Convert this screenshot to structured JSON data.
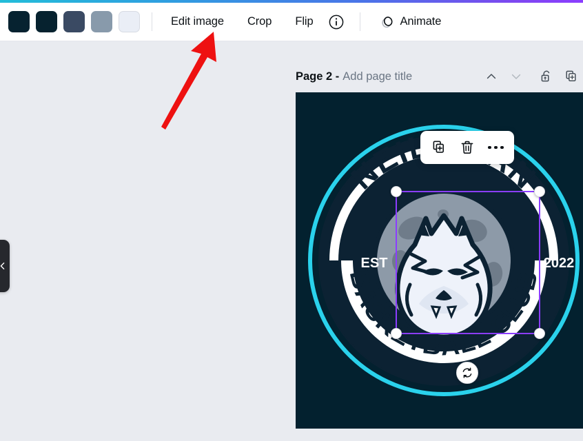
{
  "app": {
    "brand_gradient_start": "#23bdd9",
    "brand_gradient_end": "#8b3dff",
    "accent_selection": "#8b3dff"
  },
  "toolbar": {
    "swatches": [
      {
        "name": "swatch-1",
        "color": "#062230"
      },
      {
        "name": "swatch-2",
        "color": "#06222f"
      },
      {
        "name": "swatch-3",
        "color": "#3a4a63"
      },
      {
        "name": "swatch-4",
        "color": "#889aab"
      },
      {
        "name": "swatch-5",
        "color": "#eaeef6"
      }
    ],
    "edit_image_label": "Edit image",
    "crop_label": "Crop",
    "flip_label": "Flip",
    "info_icon": "info-circle-icon",
    "animate_icon": "animate-icon",
    "animate_label": "Animate"
  },
  "sidebar": {
    "collapse_icon": "chevron-left-icon"
  },
  "annotation": {
    "arrow_color": "#ee1111",
    "arrow_name": "red-pointer-arrow",
    "points_to": "Edit image"
  },
  "page_header": {
    "page_label": "Page 2 -",
    "title_placeholder": "Add page title",
    "move_up_icon": "chevron-up-icon",
    "move_down_icon": "chevron-down-icon",
    "lock_icon": "unlock-icon",
    "duplicate_page_icon": "duplicate-page-icon"
  },
  "element_toolbar": {
    "duplicate_icon": "duplicate-icon",
    "delete_icon": "trash-icon",
    "more_icon": "more-options-icon"
  },
  "canvas": {
    "background": "#03212f",
    "selection_border": "#8b3dff",
    "rotate_icon": "rotate-icon",
    "logo": {
      "top_arc_text": "NEIL TRAN",
      "bottom_arc_text": "BASKETBALL CLUB",
      "left_text": "EST",
      "right_text": "2022",
      "ring_color": "#2ad2ec",
      "dark_color": "#0c2233",
      "moon_color": "#8d9aa8",
      "wolf_color": "#eef2fa"
    }
  }
}
